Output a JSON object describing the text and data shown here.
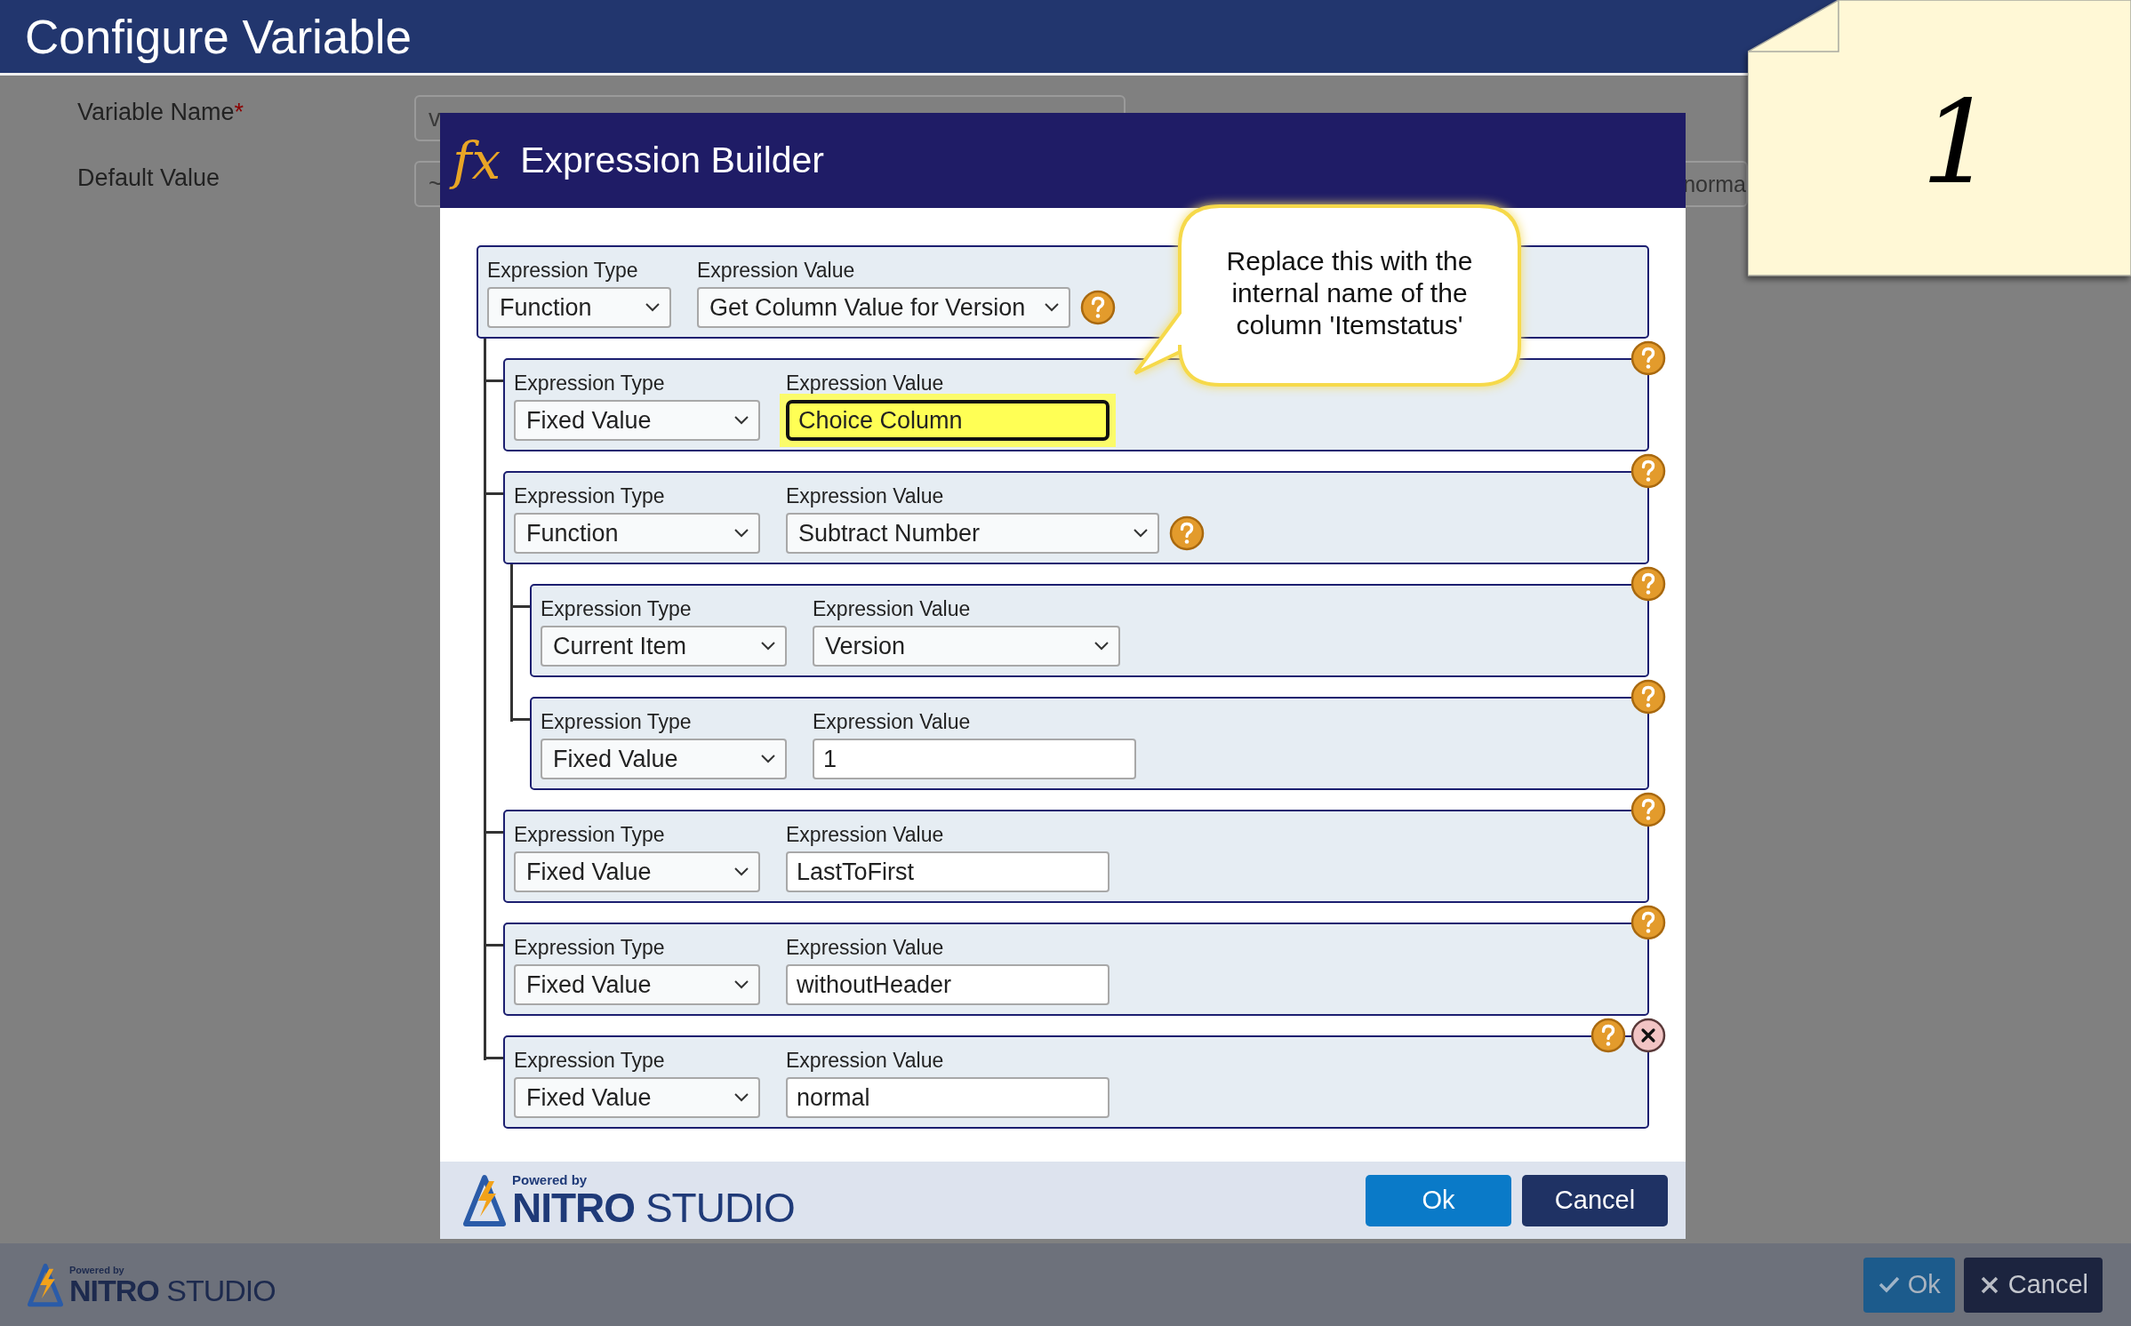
{
  "page": {
    "title": "Configure Variable",
    "fields": [
      {
        "label": "Variable Name",
        "marker": "*",
        "value": "v"
      },
      {
        "label": "Default Value",
        "value": "~",
        "value_right": "norma"
      }
    ]
  },
  "modal": {
    "badge": "fx",
    "title": "Expression Builder",
    "tree": {
      "type_label": "Expression Type",
      "value_label": "Expression Value",
      "type": "Function",
      "value": "Get Column Value for Version",
      "kind": "function",
      "inline_help": true,
      "corner_help": false,
      "removable": false,
      "highlighted": false,
      "children": [
        {
          "type_label": "Expression Type",
          "value_label": "Expression Value",
          "type": "Fixed Value",
          "value": "Choice Column",
          "kind": "text",
          "inline_help": false,
          "corner_help": true,
          "removable": false,
          "highlighted": true
        },
        {
          "type_label": "Expression Type",
          "value_label": "Expression Value",
          "type": "Function",
          "value": "Subtract Number",
          "kind": "function",
          "inline_help": true,
          "corner_help": true,
          "removable": false,
          "highlighted": false,
          "children": [
            {
              "type_label": "Expression Type",
              "value_label": "Expression Value",
              "type": "Current Item",
              "value": "Version",
              "kind": "select",
              "inline_help": false,
              "corner_help": true,
              "removable": false,
              "highlighted": false
            },
            {
              "type_label": "Expression Type",
              "value_label": "Expression Value",
              "type": "Fixed Value",
              "value": "1",
              "kind": "text",
              "inline_help": false,
              "corner_help": true,
              "removable": false,
              "highlighted": false
            }
          ]
        },
        {
          "type_label": "Expression Type",
          "value_label": "Expression Value",
          "type": "Fixed Value",
          "value": "LastToFirst",
          "kind": "text",
          "inline_help": false,
          "corner_help": true,
          "removable": false,
          "highlighted": false
        },
        {
          "type_label": "Expression Type",
          "value_label": "Expression Value",
          "type": "Fixed Value",
          "value": "withoutHeader",
          "kind": "text",
          "inline_help": false,
          "corner_help": true,
          "removable": false,
          "highlighted": false
        },
        {
          "type_label": "Expression Type",
          "value_label": "Expression Value",
          "type": "Fixed Value",
          "value": "normal",
          "kind": "text",
          "inline_help": false,
          "corner_help": true,
          "removable": true,
          "highlighted": false
        }
      ]
    },
    "callout": "Replace this with the internal name of the column 'Itemstatus'",
    "logo": {
      "tagline": "Powered by",
      "wordmark": "**NITRO** STUDIO"
    },
    "buttons": [
      {
        "label": "Ok",
        "kind": "primary"
      },
      {
        "label": "Cancel",
        "kind": "secondary"
      }
    ]
  },
  "note": {
    "number": "1"
  },
  "footer": {
    "logo": {
      "tagline": "Powered by",
      "wordmark": "**NITRO** STUDIO"
    },
    "buttons": [
      {
        "label": "Ok",
        "kind": "primary"
      },
      {
        "label": "Cancel",
        "kind": "secondary"
      }
    ]
  }
}
